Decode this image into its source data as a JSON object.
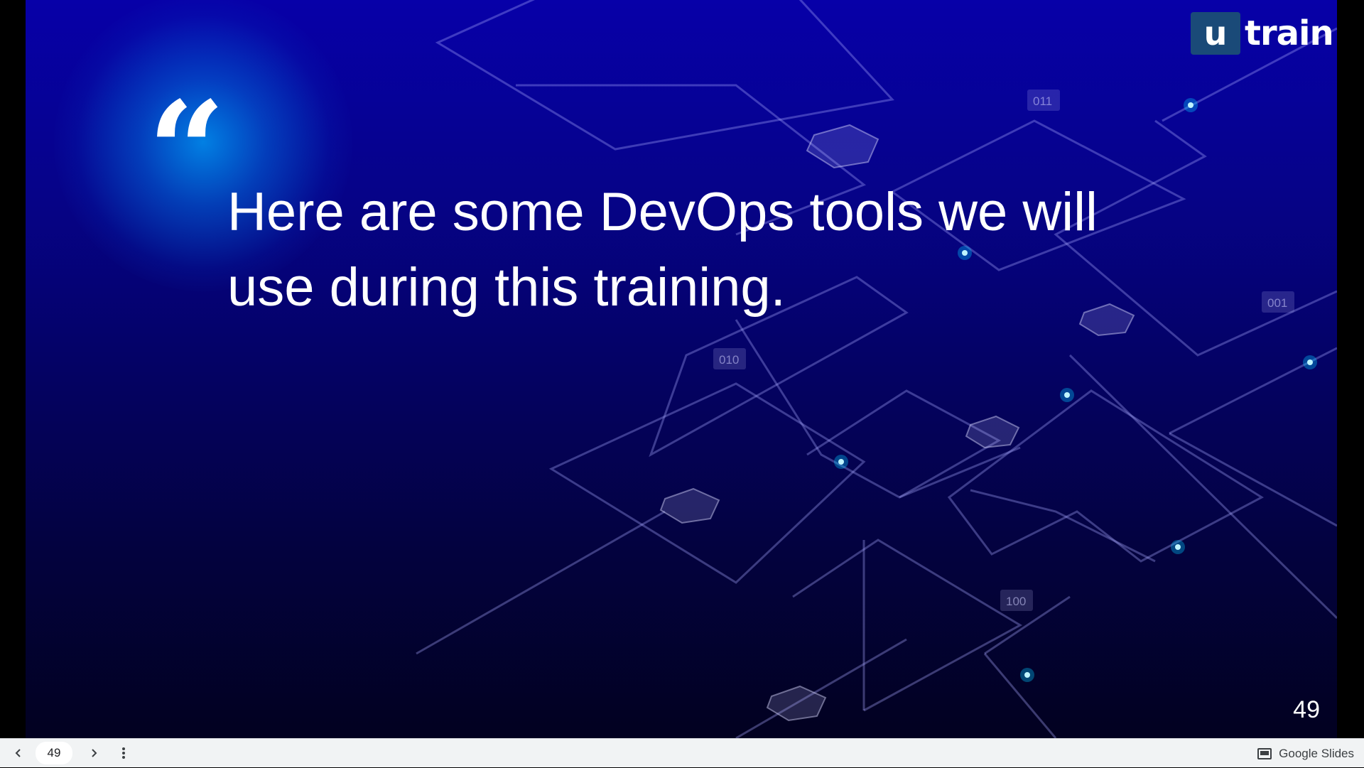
{
  "slide": {
    "quote_mark": "“",
    "quote_text": "Here are some DevOps tools we will use during this training.",
    "page_number": "49",
    "background_labels": [
      "011",
      "001",
      "010",
      "100"
    ]
  },
  "logo": {
    "box_letter": "u",
    "word": "train"
  },
  "toolbar": {
    "prev_icon": "chevron-left-icon",
    "next_icon": "chevron-right-icon",
    "more_icon": "more-vertical-icon",
    "page_value": "49",
    "brand_label": "Google Slides"
  },
  "colors": {
    "slide_top": "#0700a8",
    "slide_bottom": "#020120",
    "logo_box": "#1a4a78",
    "glow": "#00aaff",
    "toolbar_bg": "#f1f3f4"
  }
}
